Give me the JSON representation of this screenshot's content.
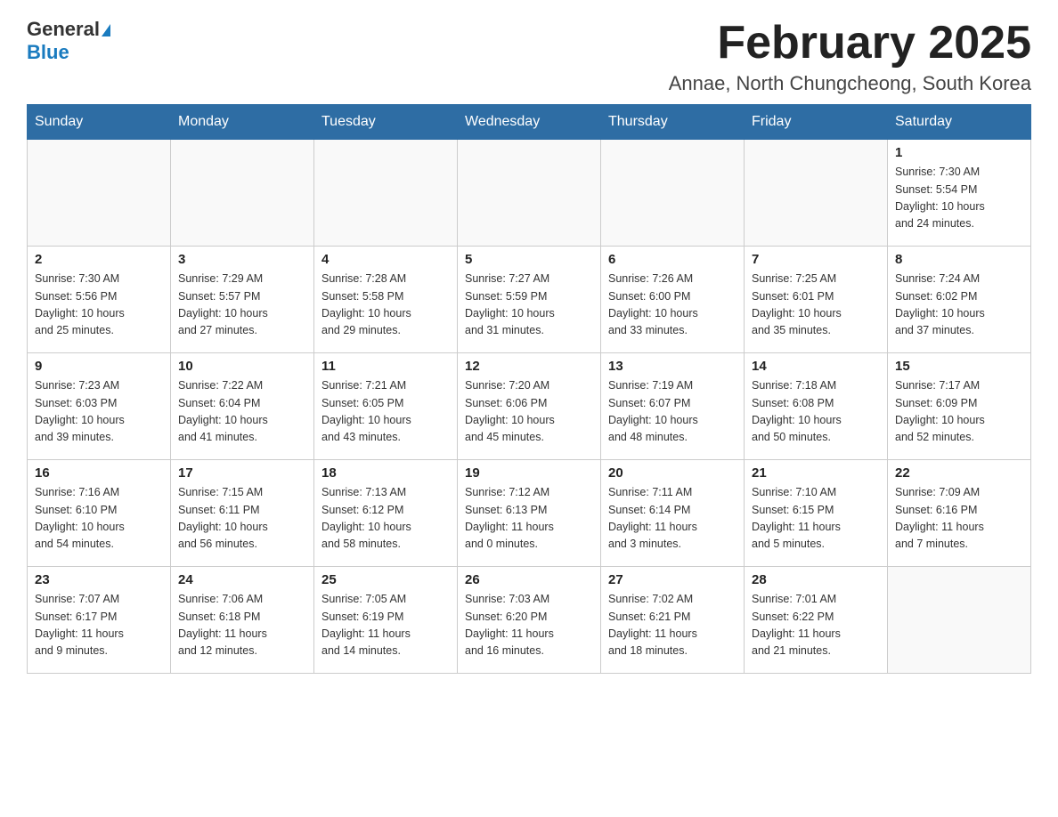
{
  "header": {
    "logo_general": "General",
    "logo_blue": "Blue",
    "title": "February 2025",
    "subtitle": "Annae, North Chungcheong, South Korea"
  },
  "calendar": {
    "days_of_week": [
      "Sunday",
      "Monday",
      "Tuesday",
      "Wednesday",
      "Thursday",
      "Friday",
      "Saturday"
    ],
    "weeks": [
      [
        {
          "day": "",
          "info": ""
        },
        {
          "day": "",
          "info": ""
        },
        {
          "day": "",
          "info": ""
        },
        {
          "day": "",
          "info": ""
        },
        {
          "day": "",
          "info": ""
        },
        {
          "day": "",
          "info": ""
        },
        {
          "day": "1",
          "info": "Sunrise: 7:30 AM\nSunset: 5:54 PM\nDaylight: 10 hours\nand 24 minutes."
        }
      ],
      [
        {
          "day": "2",
          "info": "Sunrise: 7:30 AM\nSunset: 5:56 PM\nDaylight: 10 hours\nand 25 minutes."
        },
        {
          "day": "3",
          "info": "Sunrise: 7:29 AM\nSunset: 5:57 PM\nDaylight: 10 hours\nand 27 minutes."
        },
        {
          "day": "4",
          "info": "Sunrise: 7:28 AM\nSunset: 5:58 PM\nDaylight: 10 hours\nand 29 minutes."
        },
        {
          "day": "5",
          "info": "Sunrise: 7:27 AM\nSunset: 5:59 PM\nDaylight: 10 hours\nand 31 minutes."
        },
        {
          "day": "6",
          "info": "Sunrise: 7:26 AM\nSunset: 6:00 PM\nDaylight: 10 hours\nand 33 minutes."
        },
        {
          "day": "7",
          "info": "Sunrise: 7:25 AM\nSunset: 6:01 PM\nDaylight: 10 hours\nand 35 minutes."
        },
        {
          "day": "8",
          "info": "Sunrise: 7:24 AM\nSunset: 6:02 PM\nDaylight: 10 hours\nand 37 minutes."
        }
      ],
      [
        {
          "day": "9",
          "info": "Sunrise: 7:23 AM\nSunset: 6:03 PM\nDaylight: 10 hours\nand 39 minutes."
        },
        {
          "day": "10",
          "info": "Sunrise: 7:22 AM\nSunset: 6:04 PM\nDaylight: 10 hours\nand 41 minutes."
        },
        {
          "day": "11",
          "info": "Sunrise: 7:21 AM\nSunset: 6:05 PM\nDaylight: 10 hours\nand 43 minutes."
        },
        {
          "day": "12",
          "info": "Sunrise: 7:20 AM\nSunset: 6:06 PM\nDaylight: 10 hours\nand 45 minutes."
        },
        {
          "day": "13",
          "info": "Sunrise: 7:19 AM\nSunset: 6:07 PM\nDaylight: 10 hours\nand 48 minutes."
        },
        {
          "day": "14",
          "info": "Sunrise: 7:18 AM\nSunset: 6:08 PM\nDaylight: 10 hours\nand 50 minutes."
        },
        {
          "day": "15",
          "info": "Sunrise: 7:17 AM\nSunset: 6:09 PM\nDaylight: 10 hours\nand 52 minutes."
        }
      ],
      [
        {
          "day": "16",
          "info": "Sunrise: 7:16 AM\nSunset: 6:10 PM\nDaylight: 10 hours\nand 54 minutes."
        },
        {
          "day": "17",
          "info": "Sunrise: 7:15 AM\nSunset: 6:11 PM\nDaylight: 10 hours\nand 56 minutes."
        },
        {
          "day": "18",
          "info": "Sunrise: 7:13 AM\nSunset: 6:12 PM\nDaylight: 10 hours\nand 58 minutes."
        },
        {
          "day": "19",
          "info": "Sunrise: 7:12 AM\nSunset: 6:13 PM\nDaylight: 11 hours\nand 0 minutes."
        },
        {
          "day": "20",
          "info": "Sunrise: 7:11 AM\nSunset: 6:14 PM\nDaylight: 11 hours\nand 3 minutes."
        },
        {
          "day": "21",
          "info": "Sunrise: 7:10 AM\nSunset: 6:15 PM\nDaylight: 11 hours\nand 5 minutes."
        },
        {
          "day": "22",
          "info": "Sunrise: 7:09 AM\nSunset: 6:16 PM\nDaylight: 11 hours\nand 7 minutes."
        }
      ],
      [
        {
          "day": "23",
          "info": "Sunrise: 7:07 AM\nSunset: 6:17 PM\nDaylight: 11 hours\nand 9 minutes."
        },
        {
          "day": "24",
          "info": "Sunrise: 7:06 AM\nSunset: 6:18 PM\nDaylight: 11 hours\nand 12 minutes."
        },
        {
          "day": "25",
          "info": "Sunrise: 7:05 AM\nSunset: 6:19 PM\nDaylight: 11 hours\nand 14 minutes."
        },
        {
          "day": "26",
          "info": "Sunrise: 7:03 AM\nSunset: 6:20 PM\nDaylight: 11 hours\nand 16 minutes."
        },
        {
          "day": "27",
          "info": "Sunrise: 7:02 AM\nSunset: 6:21 PM\nDaylight: 11 hours\nand 18 minutes."
        },
        {
          "day": "28",
          "info": "Sunrise: 7:01 AM\nSunset: 6:22 PM\nDaylight: 11 hours\nand 21 minutes."
        },
        {
          "day": "",
          "info": ""
        }
      ]
    ]
  }
}
